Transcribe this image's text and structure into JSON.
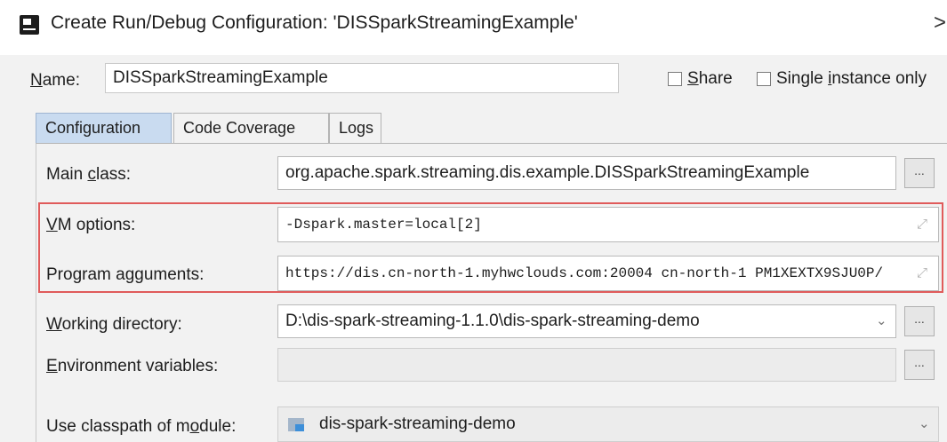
{
  "window": {
    "title": "Create Run/Debug Configuration: 'DISSparkStreamingExample'",
    "close_glyph": ">"
  },
  "name_row": {
    "label": "Name:",
    "value": "DISSparkStreamingExample",
    "share_label": "Share",
    "single_instance_label": "Single instance only",
    "share_checked": false,
    "single_instance_checked": false
  },
  "tabs": [
    {
      "label": "Configuration",
      "active": true
    },
    {
      "label": "Code Coverage",
      "active": false
    },
    {
      "label": "Logs",
      "active": false
    }
  ],
  "form": {
    "main_class": {
      "label": "Main class:",
      "value": "org.apache.spark.streaming.dis.example.DISSparkStreamingExample"
    },
    "vm_options": {
      "label": "VM options:",
      "value": "-Dspark.master=local[2]"
    },
    "program_arguments": {
      "label": "Program arguments:",
      "value": "https://dis.cn-north-1.myhwclouds.com:20004 cn-north-1 PM1XEXTX9SJU0P/"
    },
    "working_directory": {
      "label": "Working directory:",
      "value": "D:\\dis-spark-streaming-1.1.0\\dis-spark-streaming-demo"
    },
    "environment_variables": {
      "label": "Environment variables:",
      "value": ""
    },
    "classpath_module": {
      "label": "Use classpath of module:",
      "value": "dis-spark-streaming-demo"
    }
  },
  "buttons": {
    "browse_label": "..."
  },
  "colors": {
    "highlight_border": "#e05b5b",
    "active_tab": "#c9dbf0",
    "dialog_background": "#f2f2f2"
  },
  "icons": {
    "app": "run-debug-config-icon",
    "expand": "expand-icon",
    "dropdown": "chevron-down-icon",
    "module": "module-folder-icon"
  }
}
